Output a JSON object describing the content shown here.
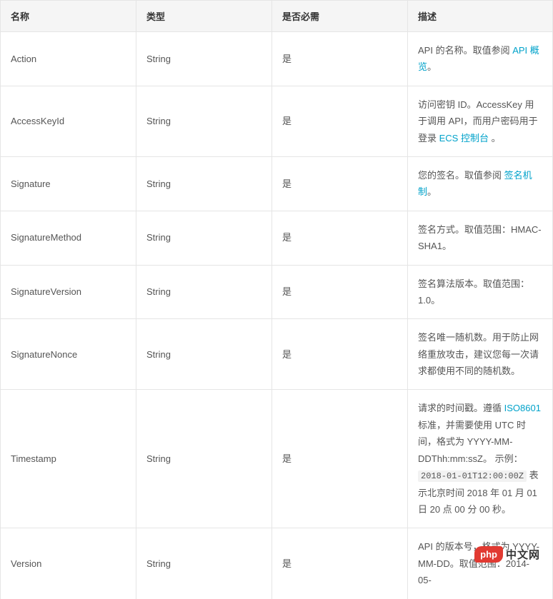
{
  "headers": {
    "name": "名称",
    "type": "类型",
    "required": "是否必需",
    "desc": "描述"
  },
  "rows": [
    {
      "name": "Action",
      "type": "String",
      "required": "是",
      "desc": {
        "pre": "API 的名称。取值参阅 ",
        "link": "API 概览",
        "post": "。"
      }
    },
    {
      "name": "AccessKeyId",
      "type": "String",
      "required": "是",
      "desc": {
        "pre": "访问密钥 ID。AccessKey 用于调用 API，而用户密码用于登录 ",
        "link": "ECS 控制台",
        "post": " 。"
      }
    },
    {
      "name": "Signature",
      "type": "String",
      "required": "是",
      "desc": {
        "pre": "您的签名。取值参阅 ",
        "link": "签名机制",
        "post": "。"
      }
    },
    {
      "name": "SignatureMethod",
      "type": "String",
      "required": "是",
      "desc": {
        "text": "签名方式。取值范围：HMAC-SHA1。"
      }
    },
    {
      "name": "SignatureVersion",
      "type": "String",
      "required": "是",
      "desc": {
        "text": "签名算法版本。取值范围：1.0。"
      }
    },
    {
      "name": "SignatureNonce",
      "type": "String",
      "required": "是",
      "desc": {
        "text": "签名唯一随机数。用于防止网络重放攻击，建议您每一次请求都使用不同的随机数。"
      }
    },
    {
      "name": "Timestamp",
      "type": "String",
      "required": "是",
      "desc": {
        "pre": "请求的时间戳。遵循 ",
        "link": "ISO8601",
        "mid": " 标准，并需要使用 UTC 时间，格式为 YYYY-MM-DDThh:mm:ssZ。 示例： ",
        "code": "2018-01-01T12:00:00Z",
        "post": " 表示北京时间 2018 年 01 月 01 日 20 点 00 分 00 秒。"
      }
    },
    {
      "name": "Version",
      "type": "String",
      "required": "是",
      "desc": {
        "text": "API 的版本号，格式为 YYYY-MM-DD。取值范围：2014-05-"
      }
    }
  ],
  "logo": {
    "badge": "php",
    "text": "中文网"
  }
}
